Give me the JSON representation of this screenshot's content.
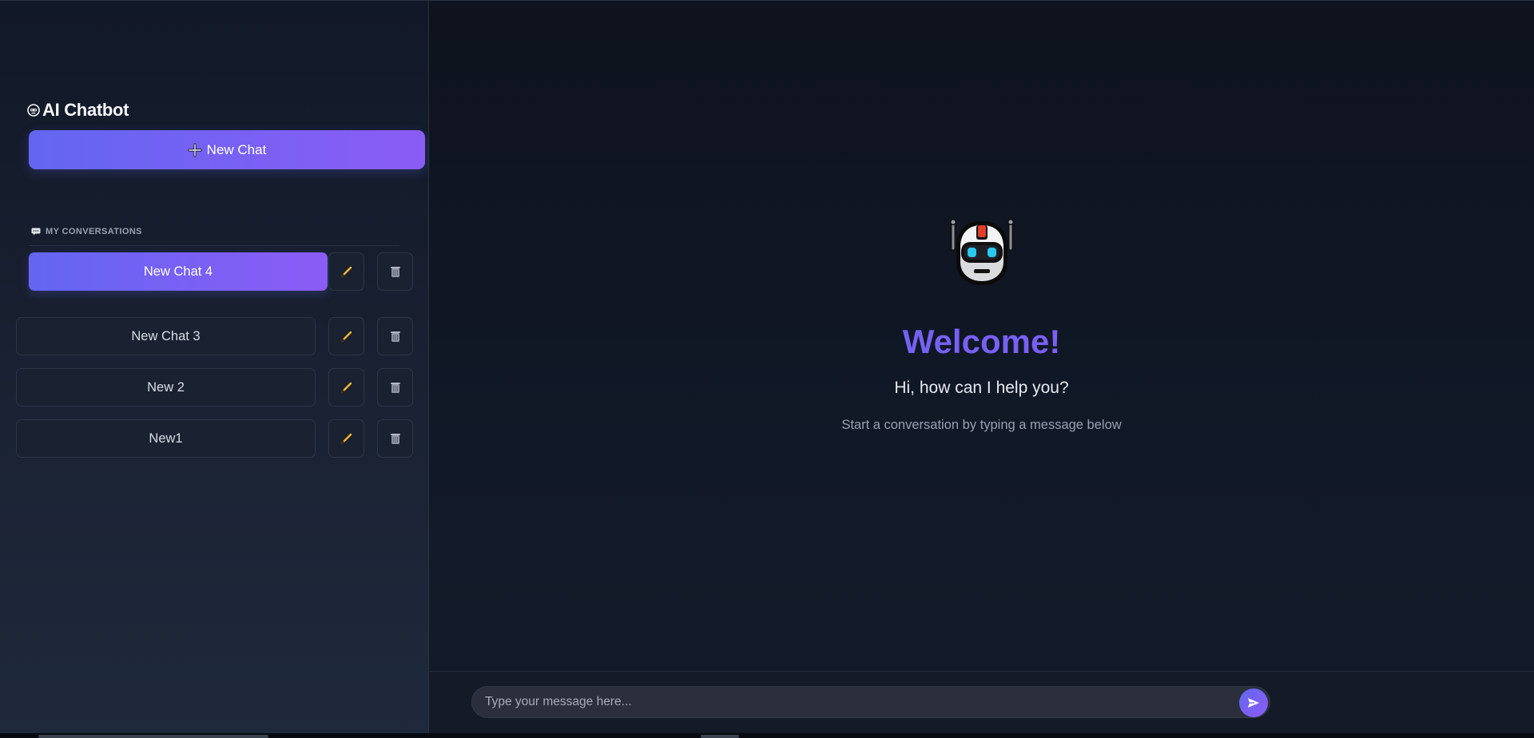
{
  "sidebar": {
    "brand": "AI Chatbot",
    "brand_icon": "robot-face-icon",
    "new_chat_label": "New Chat",
    "section_label": "MY CONVERSATIONS",
    "conversations": [
      {
        "label": "New Chat 4",
        "active": true
      },
      {
        "label": "New Chat 3",
        "active": false
      },
      {
        "label": "New 2",
        "active": false
      },
      {
        "label": "New1",
        "active": false
      }
    ]
  },
  "main": {
    "welcome_title": "Welcome!",
    "welcome_subtitle": "Hi, how can I help you?",
    "welcome_hint": "Start a conversation by typing a message below",
    "hero_icon": "robot-icon"
  },
  "composer": {
    "placeholder": "Type your message here...",
    "send_icon": "send-icon"
  },
  "colors": {
    "accent_start": "#6366f1",
    "accent_end": "#8b5cf6",
    "edit_icon": "#f5b82e",
    "background": "#0f141f"
  }
}
